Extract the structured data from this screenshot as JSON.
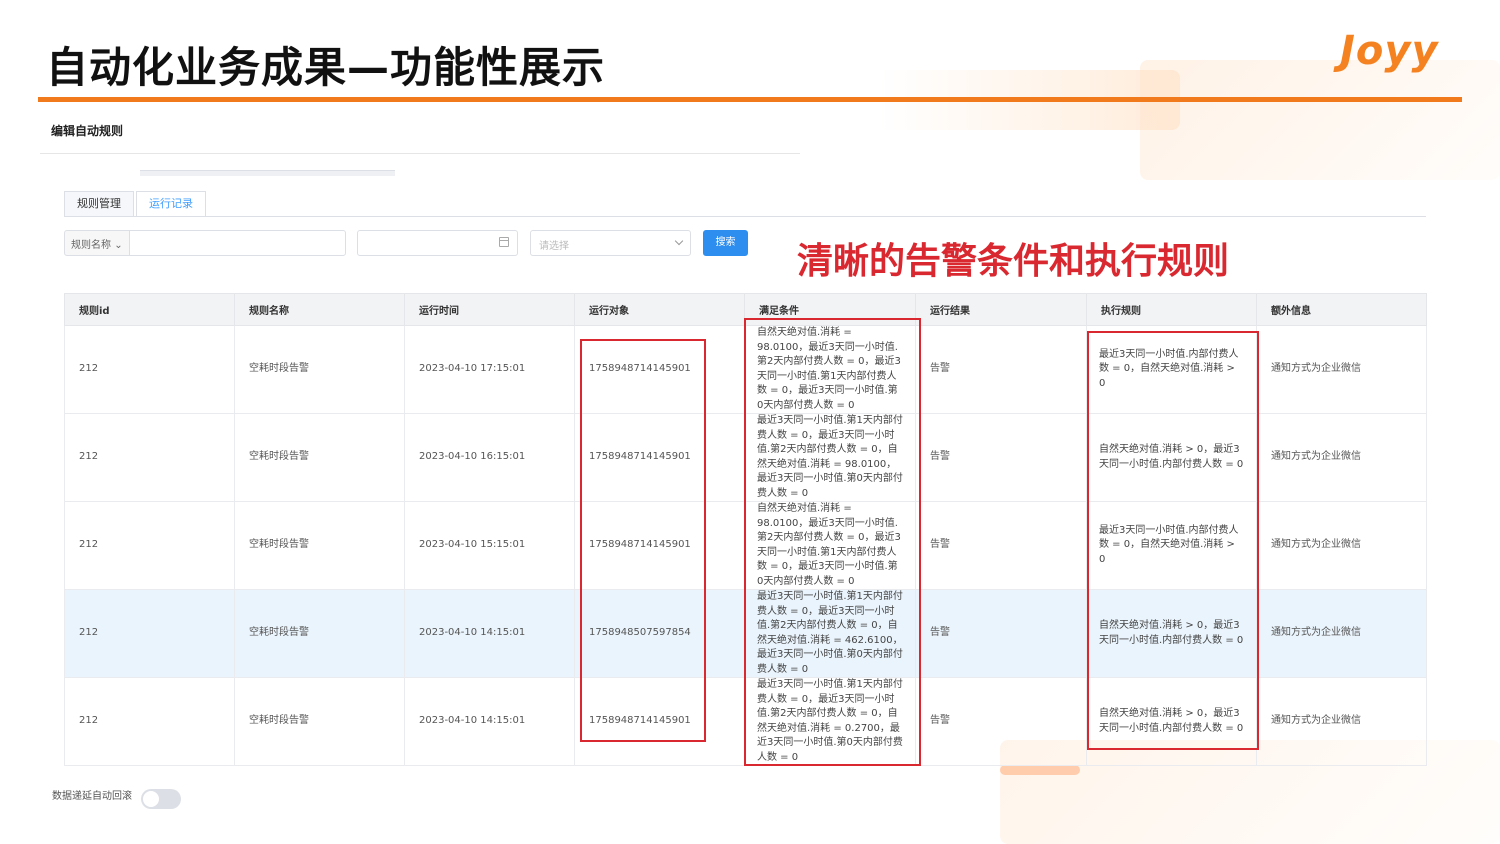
{
  "slide": {
    "title": "自动化业务成果—功能性展示",
    "logo": "Joyy",
    "annotation": "清晰的告警条件和执行规则",
    "accent_color": "#f07a1c",
    "highlight_color": "#d9282f"
  },
  "panel": {
    "title": "编辑自动规则",
    "tabs": [
      {
        "label": "规则管理",
        "active": false
      },
      {
        "label": "运行记录",
        "active": true
      }
    ]
  },
  "filters": {
    "field_selector": "规则名称",
    "name_value": "",
    "date_value": "",
    "status_placeholder": "请选择",
    "search_label": "搜索"
  },
  "table": {
    "columns": [
      "规则id",
      "规则名称",
      "运行时间",
      "运行对象",
      "满足条件",
      "运行结果",
      "执行规则",
      "额外信息"
    ],
    "rows": [
      {
        "id": "212",
        "name": "空耗时段告警",
        "time": "2023-04-10 17:15:01",
        "target": "1758948714145901",
        "condition": "自然天绝对值.消耗 = 98.0100，最近3天同一小时值.第2天内部付费人数 = 0，最近3天同一小时值.第1天内部付费人数 = 0，最近3天同一小时值.第0天内部付费人数 = 0",
        "result": "告警",
        "rule": "最近3天同一小时值.内部付费人数 = 0，自然天绝对值.消耗 > 0",
        "extra": "通知方式为企业微信"
      },
      {
        "id": "212",
        "name": "空耗时段告警",
        "time": "2023-04-10 16:15:01",
        "target": "1758948714145901",
        "condition": "最近3天同一小时值.第1天内部付费人数 = 0，最近3天同一小时值.第2天内部付费人数 = 0，自然天绝对值.消耗 = 98.0100，最近3天同一小时值.第0天内部付费人数 = 0",
        "result": "告警",
        "rule": "自然天绝对值.消耗 > 0，最近3天同一小时值.内部付费人数 = 0",
        "extra": "通知方式为企业微信"
      },
      {
        "id": "212",
        "name": "空耗时段告警",
        "time": "2023-04-10 15:15:01",
        "target": "1758948714145901",
        "condition": "自然天绝对值.消耗 = 98.0100，最近3天同一小时值.第2天内部付费人数 = 0，最近3天同一小时值.第1天内部付费人数 = 0，最近3天同一小时值.第0天内部付费人数 = 0",
        "result": "告警",
        "rule": "最近3天同一小时值.内部付费人数 = 0，自然天绝对值.消耗 > 0",
        "extra": "通知方式为企业微信"
      },
      {
        "id": "212",
        "name": "空耗时段告警",
        "time": "2023-04-10 14:15:01",
        "target": "1758948507597854",
        "condition": "最近3天同一小时值.第1天内部付费人数 = 0，最近3天同一小时值.第2天内部付费人数 = 0，自然天绝对值.消耗 = 462.6100，最近3天同一小时值.第0天内部付费人数 = 0",
        "result": "告警",
        "rule": "自然天绝对值.消耗 > 0，最近3天同一小时值.内部付费人数 = 0",
        "extra": "通知方式为企业微信"
      },
      {
        "id": "212",
        "name": "空耗时段告警",
        "time": "2023-04-10 14:15:01",
        "target": "1758948714145901",
        "condition": "最近3天同一小时值.第1天内部付费人数 = 0，最近3天同一小时值.第2天内部付费人数 = 0，自然天绝对值.消耗 = 0.2700，最近3天同一小时值.第0天内部付费人数 = 0",
        "result": "告警",
        "rule": "自然天绝对值.消耗 > 0，最近3天同一小时值.内部付费人数 = 0",
        "extra": "通知方式为企业微信"
      }
    ]
  },
  "footer": {
    "toggle_label": "数据递延自动回滚",
    "toggle_on": false
  }
}
